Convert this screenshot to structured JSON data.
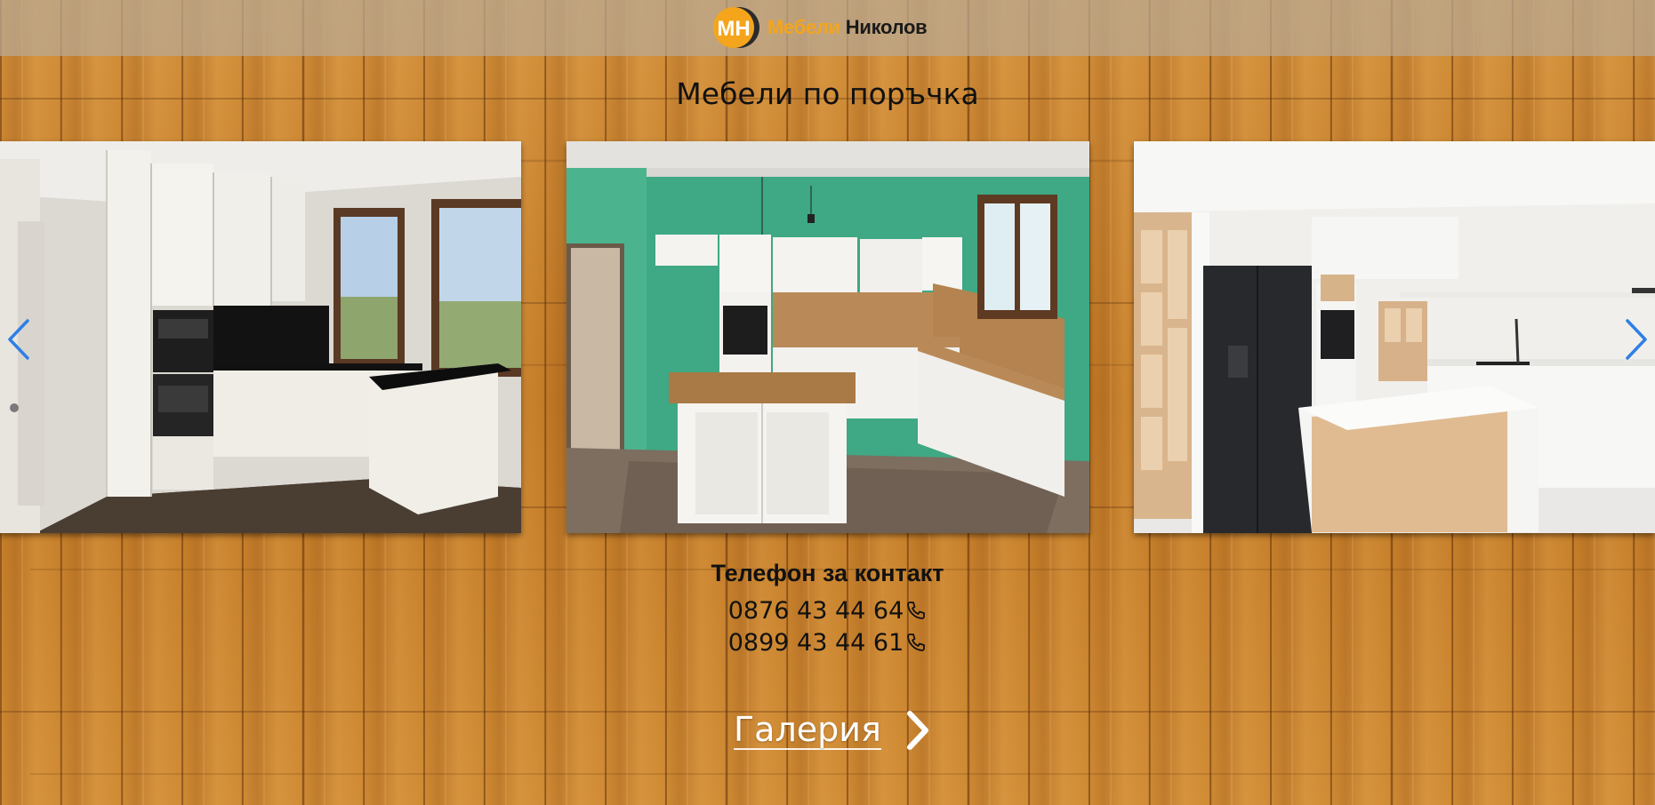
{
  "header": {
    "logo_monogram": "МН",
    "brand_primary": "Мебели",
    "brand_secondary": "Николов",
    "brand_color": "#f4a51c"
  },
  "page": {
    "title": "Мебели по поръчка"
  },
  "carousel": {
    "prev_icon": "chevron-left-icon",
    "next_icon": "chevron-right-icon",
    "arrow_color": "#2f7fe6",
    "slides": [
      {
        "name": "white-glossy-kitchen-with-black-countertop"
      },
      {
        "name": "green-wall-kitchen-with-wooden-island"
      },
      {
        "name": "white-kitchen-with-black-fridge-and-wood-shelves"
      }
    ]
  },
  "contact": {
    "title": "Телефон за контакт",
    "phones": [
      "0876 43 44 64",
      "0899 43 44 61"
    ],
    "phone_icon": "phone-icon"
  },
  "gallery": {
    "label": "Галерия",
    "icon": "chevron-right-icon"
  },
  "colors": {
    "wood": "#c8832e",
    "header_overlay": "#b9aa96"
  }
}
